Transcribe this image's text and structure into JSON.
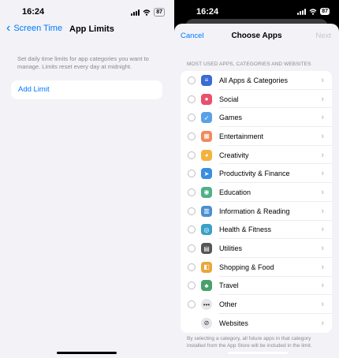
{
  "left": {
    "status": {
      "time": "16:24",
      "battery": "87"
    },
    "nav": {
      "back_label": "Screen Time",
      "title": "App Limits"
    },
    "description": "Set daily time limits for app categories you want to manage. Limits reset every day at midnight.",
    "add_limit_label": "Add Limit"
  },
  "right": {
    "status": {
      "time": "16:24",
      "battery": "87"
    },
    "sheet": {
      "cancel_label": "Cancel",
      "title": "Choose Apps",
      "next_label": "Next",
      "section_header": "MOST USED APPS, CATEGORIES AND WEBSITES",
      "items": [
        {
          "label": "All Apps & Categories",
          "icon": "stack-icon",
          "glyph": "≡",
          "color": "#3a6bd6"
        },
        {
          "label": "Social",
          "icon": "social-icon",
          "glyph": "●",
          "color": "#e8516d"
        },
        {
          "label": "Games",
          "icon": "rocket-icon",
          "glyph": "➶",
          "color": "#5aa0e8"
        },
        {
          "label": "Entertainment",
          "icon": "popcorn-icon",
          "glyph": "▦",
          "color": "#f08a5d"
        },
        {
          "label": "Creativity",
          "icon": "palette-icon",
          "glyph": "◕",
          "color": "#f2b33d"
        },
        {
          "label": "Productivity & Finance",
          "icon": "paper-plane-icon",
          "glyph": "➤",
          "color": "#3a8de0"
        },
        {
          "label": "Education",
          "icon": "globe-icon",
          "glyph": "◉",
          "color": "#4fb08a"
        },
        {
          "label": "Information & Reading",
          "icon": "book-icon",
          "glyph": "▥",
          "color": "#4a8fd0"
        },
        {
          "label": "Health & Fitness",
          "icon": "bicycle-icon",
          "glyph": "◎",
          "color": "#3aa0c8"
        },
        {
          "label": "Utilities",
          "icon": "calculator-icon",
          "glyph": "▤",
          "color": "#555555"
        },
        {
          "label": "Shopping & Food",
          "icon": "shopping-bag-icon",
          "glyph": "◧",
          "color": "#e8a73a"
        },
        {
          "label": "Travel",
          "icon": "palm-tree-icon",
          "glyph": "♣",
          "color": "#48a06a"
        },
        {
          "label": "Other",
          "icon": "more-dots-icon",
          "glyph": "•••",
          "color": "#e5e5ea"
        },
        {
          "label": "Websites",
          "icon": "compass-icon",
          "glyph": "⊘",
          "color": "#e5e5ea"
        }
      ],
      "footer": "By selecting a category, all future apps in that category installed from the App Store will be included in the limit."
    }
  }
}
